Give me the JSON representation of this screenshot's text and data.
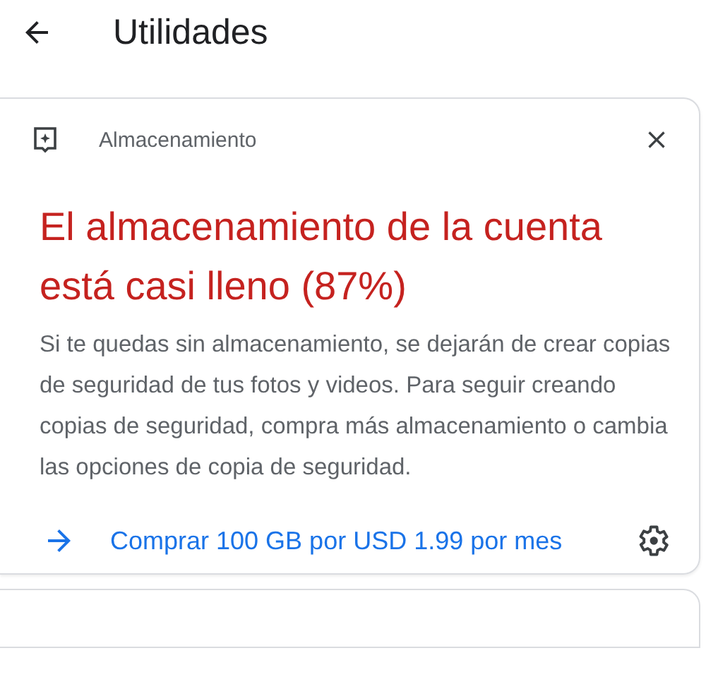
{
  "app_bar": {
    "title": "Utilidades"
  },
  "cards": [
    {
      "category": "Almacenamiento",
      "headline": "El almacenamiento de la cuenta está casi lleno (87%)",
      "body": "Si te quedas sin almacenamiento, se dejarán de crear copias de seguridad de tus fotos y videos. Para seguir creando copias de seguridad, compra más almacenamiento o cambia las opciones de copia de seguridad.",
      "action": "Comprar 100 GB por USD 1.99 por mes"
    }
  ]
}
